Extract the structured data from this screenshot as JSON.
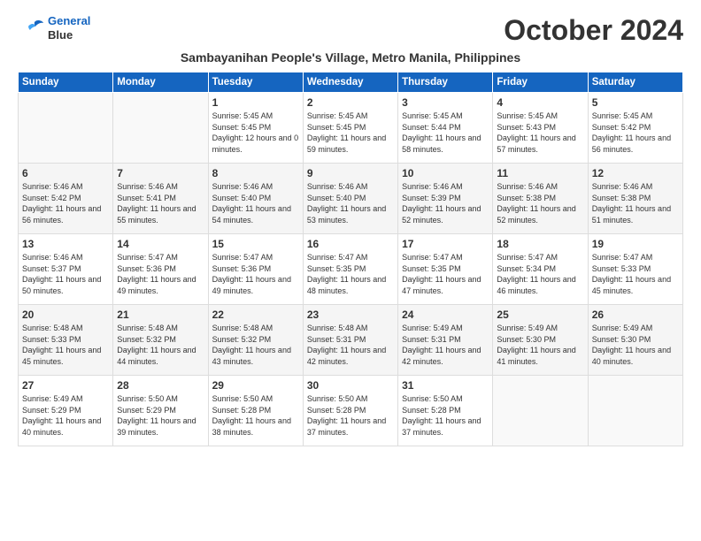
{
  "logo": {
    "line1": "General",
    "line2": "Blue"
  },
  "title": "October 2024",
  "subtitle": "Sambayanihan People's Village, Metro Manila, Philippines",
  "weekdays": [
    "Sunday",
    "Monday",
    "Tuesday",
    "Wednesday",
    "Thursday",
    "Friday",
    "Saturday"
  ],
  "weeks": [
    [
      {
        "day": "",
        "sunrise": "",
        "sunset": "",
        "daylight": ""
      },
      {
        "day": "",
        "sunrise": "",
        "sunset": "",
        "daylight": ""
      },
      {
        "day": "1",
        "sunrise": "Sunrise: 5:45 AM",
        "sunset": "Sunset: 5:45 PM",
        "daylight": "Daylight: 12 hours and 0 minutes."
      },
      {
        "day": "2",
        "sunrise": "Sunrise: 5:45 AM",
        "sunset": "Sunset: 5:45 PM",
        "daylight": "Daylight: 11 hours and 59 minutes."
      },
      {
        "day": "3",
        "sunrise": "Sunrise: 5:45 AM",
        "sunset": "Sunset: 5:44 PM",
        "daylight": "Daylight: 11 hours and 58 minutes."
      },
      {
        "day": "4",
        "sunrise": "Sunrise: 5:45 AM",
        "sunset": "Sunset: 5:43 PM",
        "daylight": "Daylight: 11 hours and 57 minutes."
      },
      {
        "day": "5",
        "sunrise": "Sunrise: 5:45 AM",
        "sunset": "Sunset: 5:42 PM",
        "daylight": "Daylight: 11 hours and 56 minutes."
      }
    ],
    [
      {
        "day": "6",
        "sunrise": "Sunrise: 5:46 AM",
        "sunset": "Sunset: 5:42 PM",
        "daylight": "Daylight: 11 hours and 56 minutes."
      },
      {
        "day": "7",
        "sunrise": "Sunrise: 5:46 AM",
        "sunset": "Sunset: 5:41 PM",
        "daylight": "Daylight: 11 hours and 55 minutes."
      },
      {
        "day": "8",
        "sunrise": "Sunrise: 5:46 AM",
        "sunset": "Sunset: 5:40 PM",
        "daylight": "Daylight: 11 hours and 54 minutes."
      },
      {
        "day": "9",
        "sunrise": "Sunrise: 5:46 AM",
        "sunset": "Sunset: 5:40 PM",
        "daylight": "Daylight: 11 hours and 53 minutes."
      },
      {
        "day": "10",
        "sunrise": "Sunrise: 5:46 AM",
        "sunset": "Sunset: 5:39 PM",
        "daylight": "Daylight: 11 hours and 52 minutes."
      },
      {
        "day": "11",
        "sunrise": "Sunrise: 5:46 AM",
        "sunset": "Sunset: 5:38 PM",
        "daylight": "Daylight: 11 hours and 52 minutes."
      },
      {
        "day": "12",
        "sunrise": "Sunrise: 5:46 AM",
        "sunset": "Sunset: 5:38 PM",
        "daylight": "Daylight: 11 hours and 51 minutes."
      }
    ],
    [
      {
        "day": "13",
        "sunrise": "Sunrise: 5:46 AM",
        "sunset": "Sunset: 5:37 PM",
        "daylight": "Daylight: 11 hours and 50 minutes."
      },
      {
        "day": "14",
        "sunrise": "Sunrise: 5:47 AM",
        "sunset": "Sunset: 5:36 PM",
        "daylight": "Daylight: 11 hours and 49 minutes."
      },
      {
        "day": "15",
        "sunrise": "Sunrise: 5:47 AM",
        "sunset": "Sunset: 5:36 PM",
        "daylight": "Daylight: 11 hours and 49 minutes."
      },
      {
        "day": "16",
        "sunrise": "Sunrise: 5:47 AM",
        "sunset": "Sunset: 5:35 PM",
        "daylight": "Daylight: 11 hours and 48 minutes."
      },
      {
        "day": "17",
        "sunrise": "Sunrise: 5:47 AM",
        "sunset": "Sunset: 5:35 PM",
        "daylight": "Daylight: 11 hours and 47 minutes."
      },
      {
        "day": "18",
        "sunrise": "Sunrise: 5:47 AM",
        "sunset": "Sunset: 5:34 PM",
        "daylight": "Daylight: 11 hours and 46 minutes."
      },
      {
        "day": "19",
        "sunrise": "Sunrise: 5:47 AM",
        "sunset": "Sunset: 5:33 PM",
        "daylight": "Daylight: 11 hours and 45 minutes."
      }
    ],
    [
      {
        "day": "20",
        "sunrise": "Sunrise: 5:48 AM",
        "sunset": "Sunset: 5:33 PM",
        "daylight": "Daylight: 11 hours and 45 minutes."
      },
      {
        "day": "21",
        "sunrise": "Sunrise: 5:48 AM",
        "sunset": "Sunset: 5:32 PM",
        "daylight": "Daylight: 11 hours and 44 minutes."
      },
      {
        "day": "22",
        "sunrise": "Sunrise: 5:48 AM",
        "sunset": "Sunset: 5:32 PM",
        "daylight": "Daylight: 11 hours and 43 minutes."
      },
      {
        "day": "23",
        "sunrise": "Sunrise: 5:48 AM",
        "sunset": "Sunset: 5:31 PM",
        "daylight": "Daylight: 11 hours and 42 minutes."
      },
      {
        "day": "24",
        "sunrise": "Sunrise: 5:49 AM",
        "sunset": "Sunset: 5:31 PM",
        "daylight": "Daylight: 11 hours and 42 minutes."
      },
      {
        "day": "25",
        "sunrise": "Sunrise: 5:49 AM",
        "sunset": "Sunset: 5:30 PM",
        "daylight": "Daylight: 11 hours and 41 minutes."
      },
      {
        "day": "26",
        "sunrise": "Sunrise: 5:49 AM",
        "sunset": "Sunset: 5:30 PM",
        "daylight": "Daylight: 11 hours and 40 minutes."
      }
    ],
    [
      {
        "day": "27",
        "sunrise": "Sunrise: 5:49 AM",
        "sunset": "Sunset: 5:29 PM",
        "daylight": "Daylight: 11 hours and 40 minutes."
      },
      {
        "day": "28",
        "sunrise": "Sunrise: 5:50 AM",
        "sunset": "Sunset: 5:29 PM",
        "daylight": "Daylight: 11 hours and 39 minutes."
      },
      {
        "day": "29",
        "sunrise": "Sunrise: 5:50 AM",
        "sunset": "Sunset: 5:28 PM",
        "daylight": "Daylight: 11 hours and 38 minutes."
      },
      {
        "day": "30",
        "sunrise": "Sunrise: 5:50 AM",
        "sunset": "Sunset: 5:28 PM",
        "daylight": "Daylight: 11 hours and 37 minutes."
      },
      {
        "day": "31",
        "sunrise": "Sunrise: 5:50 AM",
        "sunset": "Sunset: 5:28 PM",
        "daylight": "Daylight: 11 hours and 37 minutes."
      },
      {
        "day": "",
        "sunrise": "",
        "sunset": "",
        "daylight": ""
      },
      {
        "day": "",
        "sunrise": "",
        "sunset": "",
        "daylight": ""
      }
    ]
  ]
}
